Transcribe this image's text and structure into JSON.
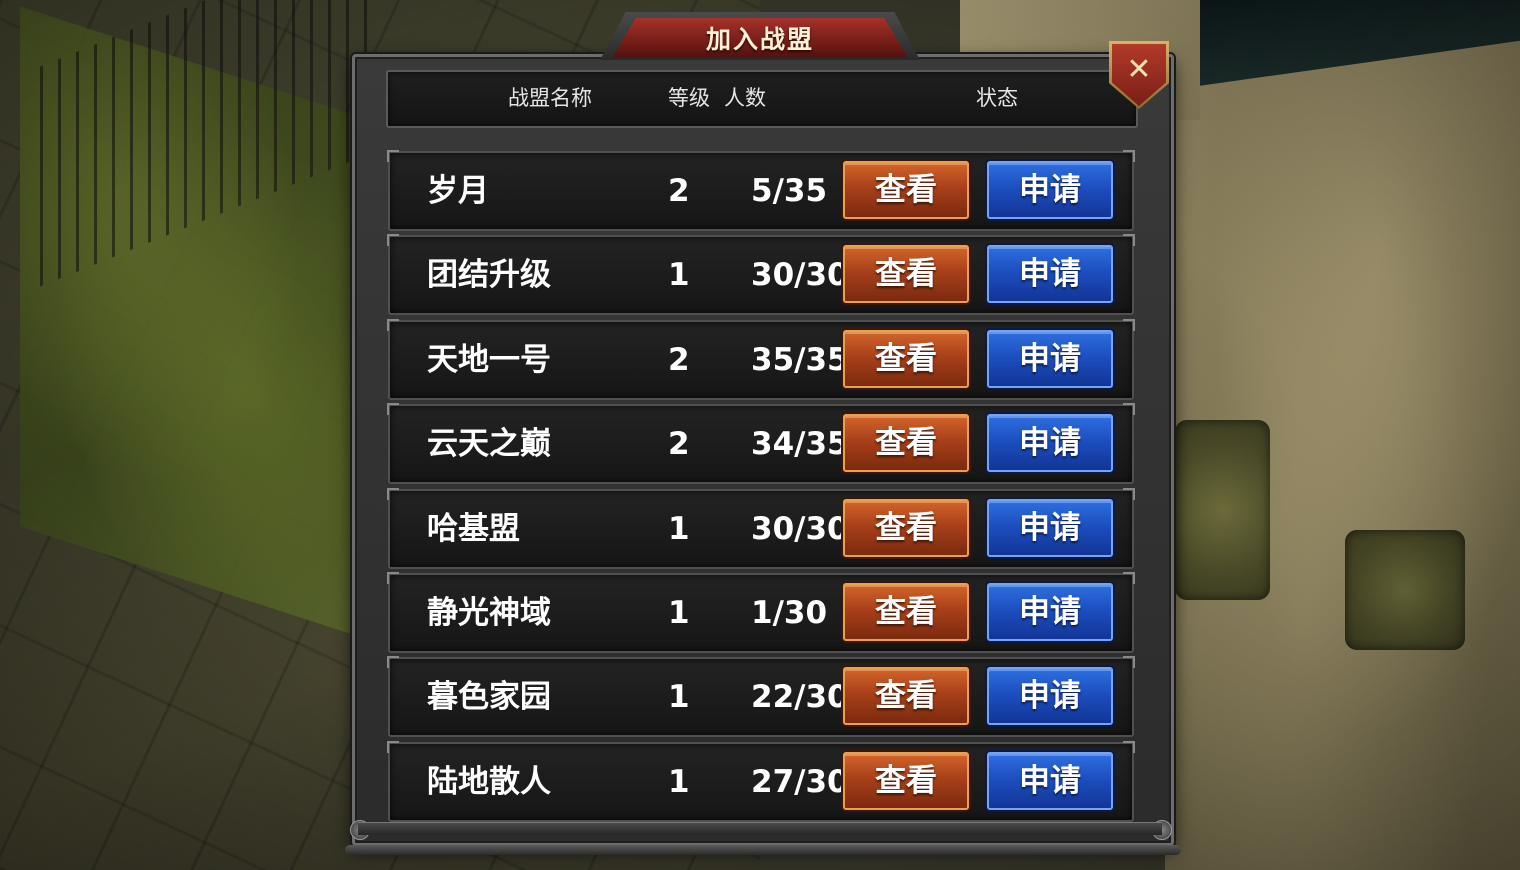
{
  "dialog": {
    "title": "加入战盟",
    "close_icon": "close-x-icon",
    "columns": {
      "name": "战盟名称",
      "level": "等级",
      "members": "人数",
      "status": "状态"
    },
    "view_label": "查看",
    "apply_label": "申请",
    "rows": [
      {
        "name": "岁月",
        "level": "2",
        "members": "5/35"
      },
      {
        "name": "团结升级",
        "level": "1",
        "members": "30/30"
      },
      {
        "name": "天地一号",
        "level": "2",
        "members": "35/35"
      },
      {
        "name": "云天之巅",
        "level": "2",
        "members": "34/35"
      },
      {
        "name": "哈基盟",
        "level": "1",
        "members": "30/30"
      },
      {
        "name": "静光神域",
        "level": "1",
        "members": "1/30"
      },
      {
        "name": "暮色家园",
        "level": "1",
        "members": "22/30"
      },
      {
        "name": "陆地散人",
        "level": "1",
        "members": "27/30"
      }
    ]
  },
  "colors": {
    "title_red": "#a5322a",
    "view_orange": "#c3551f",
    "apply_blue": "#2458d0",
    "panel_dark": "#2b2b2b"
  }
}
